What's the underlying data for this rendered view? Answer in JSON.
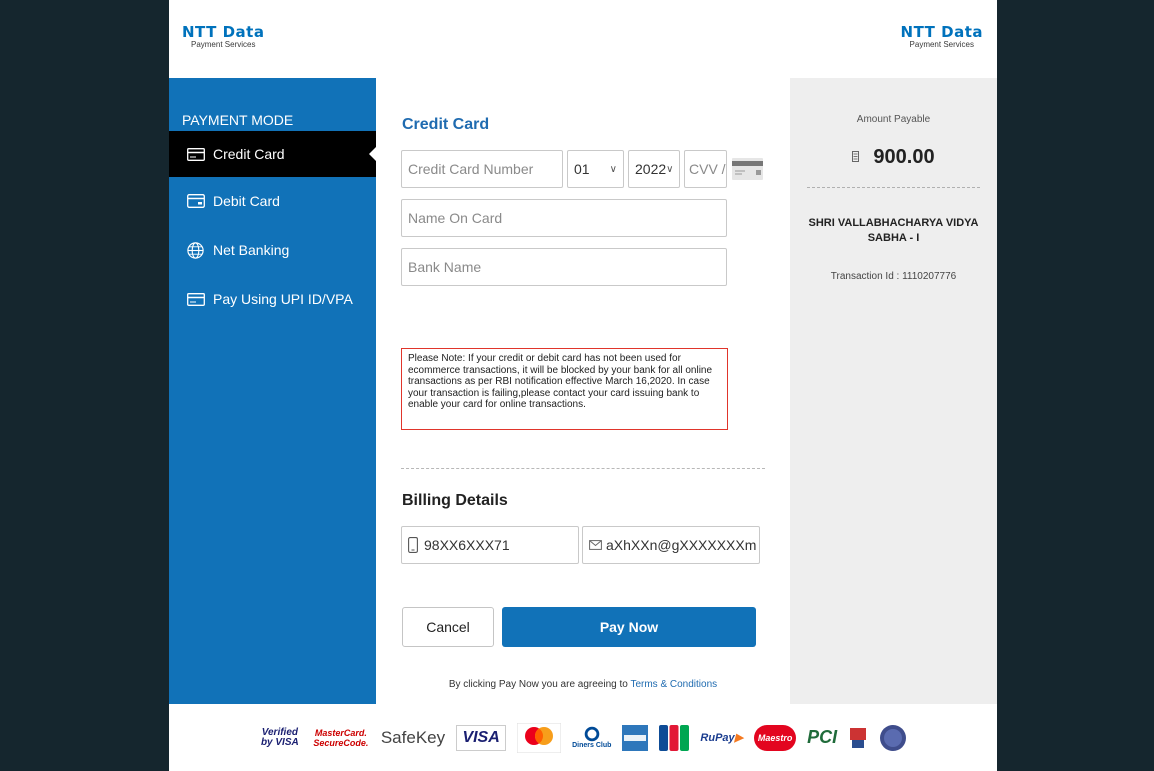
{
  "logo": {
    "main": "NTT Data",
    "sub": "Payment Services"
  },
  "sidebar": {
    "title": "PAYMENT MODE",
    "items": [
      {
        "label": "Credit Card",
        "icon": "credit-card-icon"
      },
      {
        "label": "Debit Card",
        "icon": "debit-card-icon"
      },
      {
        "label": "Net Banking",
        "icon": "globe-icon"
      },
      {
        "label": "Pay Using UPI ID/VPA",
        "icon": "upi-card-icon"
      }
    ]
  },
  "form": {
    "title": "Credit Card",
    "card_number_placeholder": "Credit Card Number",
    "month": "01",
    "year": "2022",
    "cvv_placeholder": "CVV /",
    "name_placeholder": "Name On Card",
    "bank_placeholder": "Bank Name",
    "note": "Please Note: If your credit or debit card has not been used for ecommerce transactions, it will be blocked by your bank for all online transactions as per RBI notification effective March 16,2020. In case your transaction is failing,please contact your card issuing bank to enable your card for online transactions."
  },
  "billing": {
    "title": "Billing Details",
    "phone": "98XX6XXX71",
    "email": "aXhXXn@gXXXXXXXm"
  },
  "actions": {
    "cancel": "Cancel",
    "pay": "Pay Now",
    "agree_text": "By clicking Pay Now you are agreeing to",
    "terms_link": "Terms & Conditions"
  },
  "summary": {
    "amount_label": "Amount Payable",
    "amount": "900.00",
    "merchant": "SHRI VALLABHACHARYA VIDYA SABHA - I",
    "transaction": "Transaction Id : 1110207776"
  },
  "brands": {
    "verified_visa": "Verified by VISA",
    "mc_secure": "MasterCard. SecureCode.",
    "safekey": "SafeKey",
    "visa": "VISA",
    "diners": "Diners Club",
    "rupay": "RuPay",
    "maestro": "Maestro",
    "pci": "PCI"
  },
  "colors": {
    "brand_blue": "#1172b8",
    "frame_bg": "#15262e",
    "panel_gray": "#eeeeee",
    "note_border": "#e0352b"
  }
}
